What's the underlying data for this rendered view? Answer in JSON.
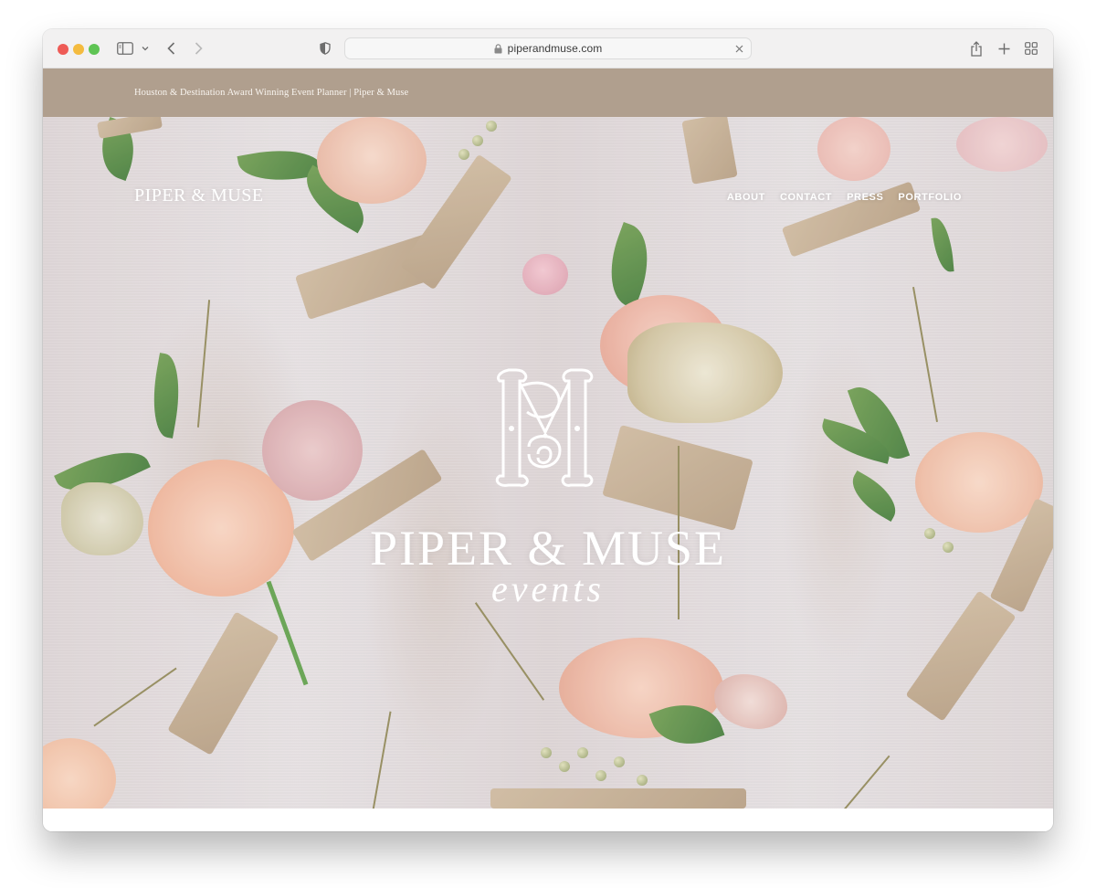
{
  "browser": {
    "url": "piperandmuse.com",
    "icons": {
      "close": "red-dot",
      "minimize": "yellow-dot",
      "zoom": "green-dot",
      "sidebar": "sidebar-icon",
      "sidebar_menu": "chevron-down-icon",
      "back": "chevron-left-icon",
      "forward": "chevron-right-icon",
      "privacy": "shield-icon",
      "secure": "lock-icon",
      "clear": "close-icon",
      "share": "share-icon",
      "new_tab": "plus-icon",
      "tab_overview": "grid-icon"
    }
  },
  "announcement": {
    "text": "Houston & Destination Award Winning Event Planner | Piper & Muse",
    "background": "#b09f8e"
  },
  "header": {
    "logo": "PIPER & MUSE",
    "nav": [
      {
        "label": "ABOUT"
      },
      {
        "label": "CONTACT"
      },
      {
        "label": "PRESS"
      },
      {
        "label": "PORTFOLIO"
      }
    ]
  },
  "hero": {
    "monogram": "PM",
    "title": "PIPER & MUSE",
    "subtitle": "events"
  }
}
